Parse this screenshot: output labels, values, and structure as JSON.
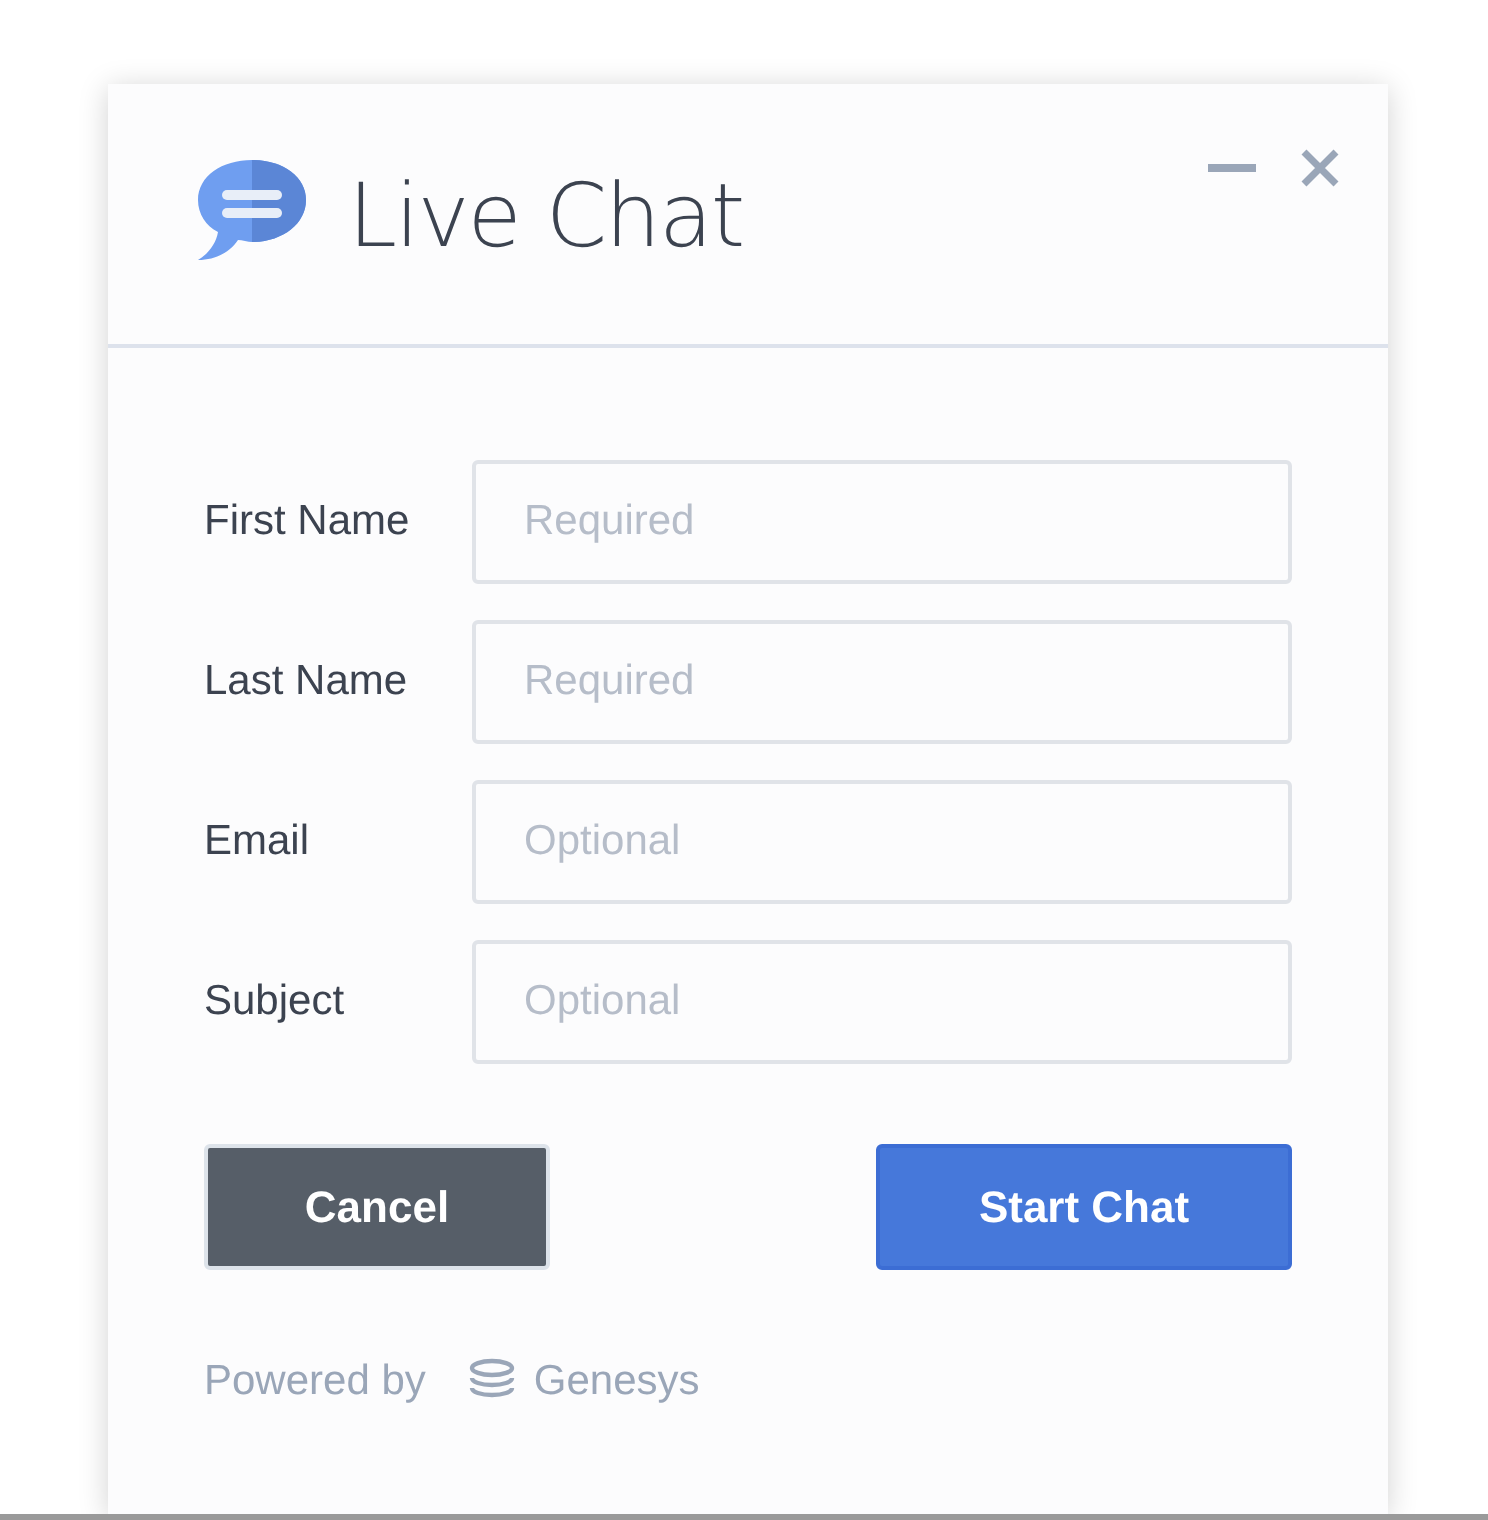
{
  "window": {
    "title": "Live Chat"
  },
  "fields": [
    {
      "label": "First Name",
      "placeholder": "Required"
    },
    {
      "label": "Last Name",
      "placeholder": "Required"
    },
    {
      "label": "Email",
      "placeholder": "Optional"
    },
    {
      "label": "Subject",
      "placeholder": "Optional"
    }
  ],
  "buttons": {
    "cancel": "Cancel",
    "start": "Start Chat"
  },
  "footer": {
    "powered_by": "Powered by",
    "brand": "Genesys"
  }
}
